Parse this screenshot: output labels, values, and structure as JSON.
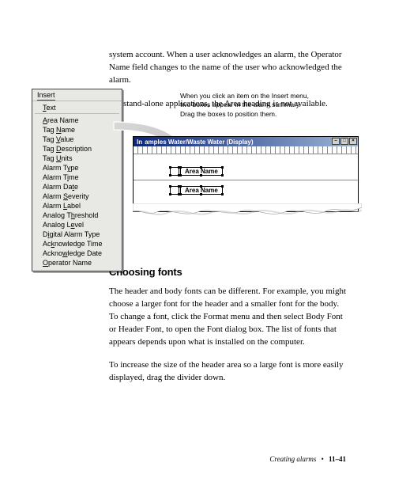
{
  "para_1": "system account. When a user acknowledges an alarm, the Operator Name field changes to the name of the user who acknowledged the alarm.",
  "para_2": "For stand-alone applications, the Area heading is not available.",
  "callout_text": "When you click an item on the Insert menu, two boxes appear in the alarm summary. Drag the boxes to position them.",
  "menu": {
    "title": "Insert",
    "items": [
      {
        "pre": "",
        "u": "T",
        "post": "ext"
      },
      {
        "pre": "",
        "u": "A",
        "post": "rea Name"
      },
      {
        "pre": "Tag ",
        "u": "N",
        "post": "ame"
      },
      {
        "pre": "Tag ",
        "u": "V",
        "post": "alue"
      },
      {
        "pre": "Tag ",
        "u": "D",
        "post": "escription"
      },
      {
        "pre": "Tag ",
        "u": "U",
        "post": "nits"
      },
      {
        "pre": "Alarm T",
        "u": "y",
        "post": "pe"
      },
      {
        "pre": "Alarm T",
        "u": "i",
        "post": "me"
      },
      {
        "pre": "Alarm Da",
        "u": "t",
        "post": "e"
      },
      {
        "pre": "Alarm ",
        "u": "S",
        "post": "everity"
      },
      {
        "pre": "Alarm ",
        "u": "L",
        "post": "abel"
      },
      {
        "pre": "Analog T",
        "u": "h",
        "post": "reshold"
      },
      {
        "pre": "Analog L",
        "u": "e",
        "post": "vel"
      },
      {
        "pre": "D",
        "u": "i",
        "post": "gital Alarm Type"
      },
      {
        "pre": "Ac",
        "u": "k",
        "post": "nowledge Time"
      },
      {
        "pre": "Ackno",
        "u": "w",
        "post": "ledge Date"
      },
      {
        "pre": "",
        "u": "O",
        "post": "perator Name"
      }
    ]
  },
  "display": {
    "title_truncated": "amples Water/Waste Water (Display)",
    "box_label_1": "Area Name",
    "box_label_2": "Area Name"
  },
  "section_heading": "Choosing fonts",
  "para_3": "The header and body fonts can be different. For example, you might choose a larger font for the header and a smaller font for the body. To change a font, click the Format menu and then select Body Font or Header Font, to open the Font dialog box. The list of fonts that appears depends upon what is installed on the computer.",
  "para_4": "To increase the size of the header area so a large font is more easily displayed, drag the divider down.",
  "footer": {
    "chapter": "Creating alarms",
    "bullet": "•",
    "page": "11–41"
  }
}
